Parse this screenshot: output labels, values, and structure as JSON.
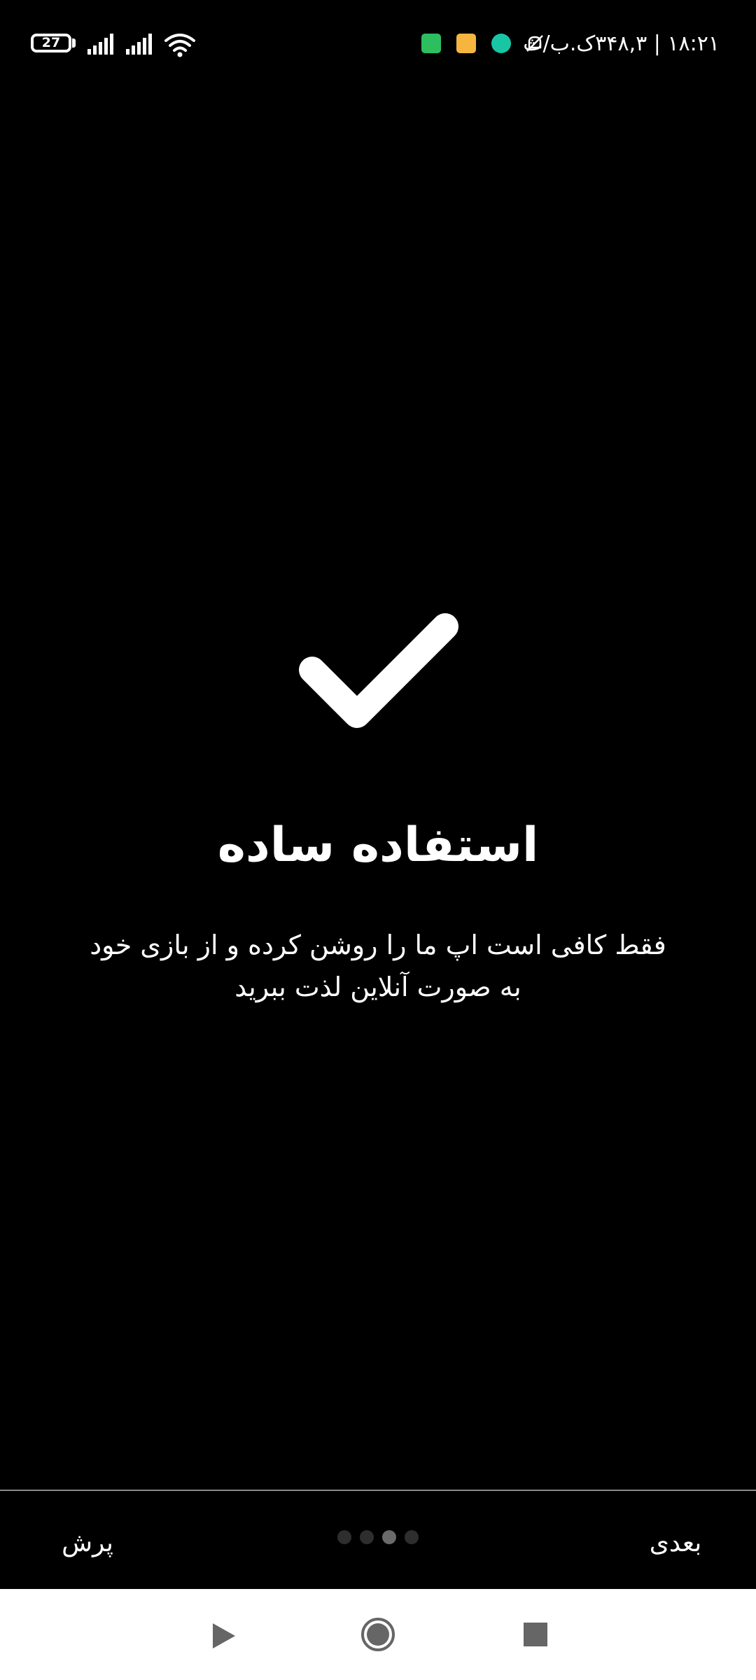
{
  "status_bar": {
    "battery_level": "27",
    "right_text": "۱۸:۲۱ | ۳۴۸,۳ک.ب/ث",
    "icons": [
      "battery-icon",
      "signal-icon",
      "signal-icon",
      "wifi-icon",
      "send-icon",
      "notes-icon",
      "chat-icon",
      "mute-icon"
    ],
    "icon_colors": {
      "send": "#2dbe60",
      "notes": "#f5b53f",
      "chat": "#18c6a6"
    }
  },
  "slide": {
    "icon": "checkmark-icon",
    "title": "استفاده ساده",
    "description": "فقط کافی است اپ ما را روشن کرده و از بازی خود به صورت آنلاین لذت ببرید"
  },
  "footer": {
    "skip_label": "پرش",
    "next_label": "بعدی",
    "page_count": 4,
    "active_page": 2,
    "colors": {
      "dot_inactive": "#2e2e2e",
      "dot_active": "#6a6a6a",
      "divider": "#8a8a8a"
    }
  },
  "nav_bar": {
    "buttons": [
      "back-icon",
      "home-icon",
      "recents-icon"
    ]
  }
}
